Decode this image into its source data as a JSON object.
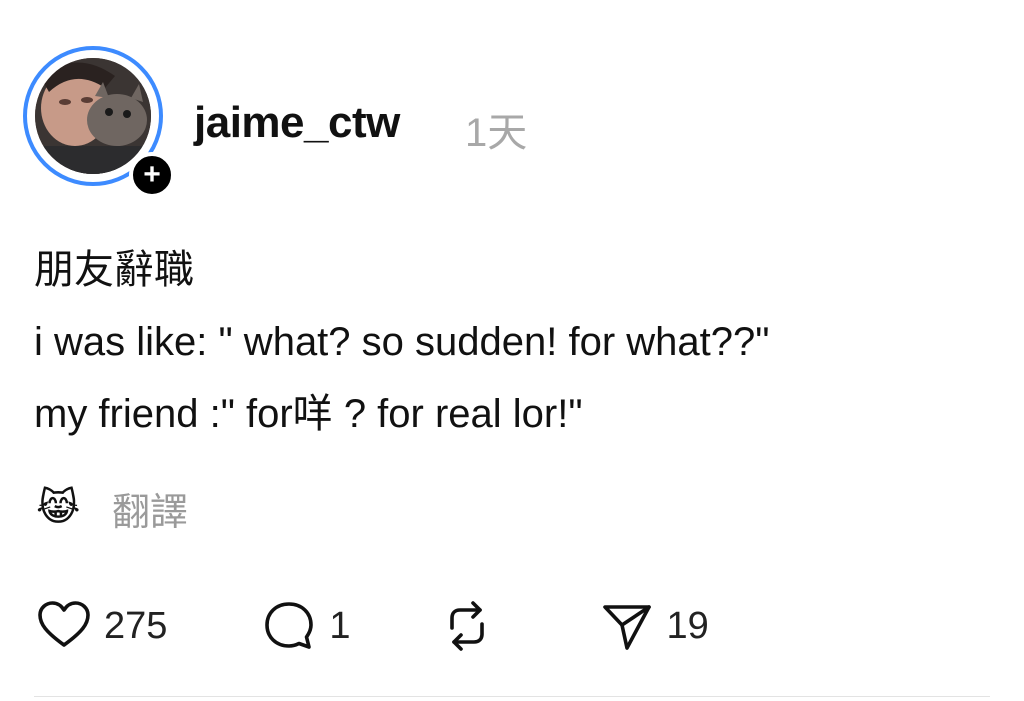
{
  "post": {
    "author": {
      "username": "jaime_ctw",
      "follow_badge": "+"
    },
    "timestamp": "1天",
    "lines": [
      "朋友辭職",
      "i was like: \" what? so sudden! for what??\"",
      "my friend :\" for咩 ? for real lor!\""
    ],
    "reaction_emoji": "😹",
    "translate_label": "翻譯",
    "actions": {
      "like_count": "275",
      "reply_count": "1",
      "share_count": "19"
    }
  },
  "colors": {
    "avatar_ring": "#3d8bff",
    "timestamp_text": "#a8a8a8",
    "translate_text": "#9a9a9a"
  },
  "icons": [
    "heart-icon",
    "comment-icon",
    "repost-icon",
    "share-icon",
    "add-user-icon"
  ]
}
